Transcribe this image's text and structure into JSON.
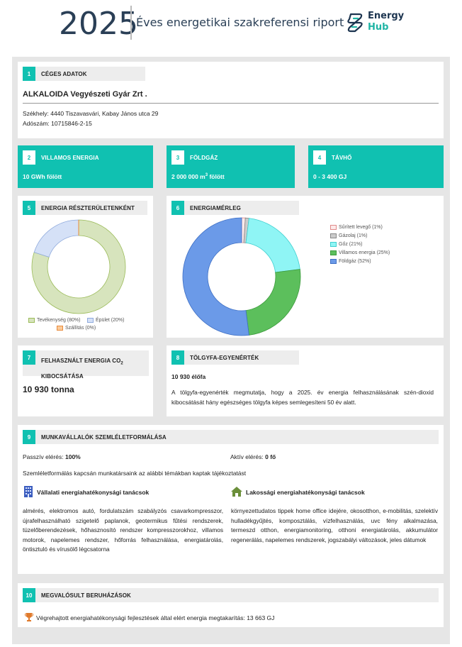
{
  "header": {
    "year": "2025",
    "title": "Éves energetikai szakreferensi riport",
    "logo_line1": "Energy",
    "logo_line2": "Hub"
  },
  "company": {
    "num": "1",
    "title": "CÉGES ADATOK",
    "name": "ALKALOIDA Vegyészeti Gyár Zrt .",
    "address": "Székhely: 4440 Tiszavasvári, Kabay János utca 29",
    "tax": "Adószám: 10715846-2-15"
  },
  "electric": {
    "num": "2",
    "title": "VILLAMOS ENERGIA",
    "value": "10 GWh fölött"
  },
  "gas": {
    "num": "3",
    "title": "FÖLDGÁZ",
    "value_main": "2 000 000 m",
    "value_sup": "3",
    "value_tail": " fölött"
  },
  "district": {
    "num": "4",
    "title": "TÁVHŐ",
    "value": "0 - 3 400 GJ"
  },
  "energy_area": {
    "num": "5",
    "title": "ENERGIA RÉSZTERÜLETENKÉNT",
    "legend": [
      {
        "label": "Tevékenység (80%)",
        "color": "#d7e4bd",
        "stroke": "#9bbb59"
      },
      {
        "label": "Épület (20%)",
        "color": "#d5e1f7",
        "stroke": "#8faadc"
      },
      {
        "label": "Szállítás (0%)",
        "color": "#fbcb9a",
        "stroke": "#e88b3c"
      }
    ]
  },
  "energy_balance": {
    "num": "6",
    "title": "ENERGIAMÉRLEG",
    "legend": [
      {
        "label": "Sűrített levegő (1%)",
        "color": "#fdeaea",
        "stroke": "#e08a8a"
      },
      {
        "label": "Gázolaj (1%)",
        "color": "#cccccc",
        "stroke": "#888888"
      },
      {
        "label": "Gőz (21%)",
        "color": "#8ff5f5",
        "stroke": "#3fd0d0"
      },
      {
        "label": "Villamos energia (25%)",
        "color": "#5cbf5c",
        "stroke": "#3c9a3c"
      },
      {
        "label": "Földgáz (52%)",
        "color": "#6b9ae8",
        "stroke": "#3e6fc4"
      }
    ]
  },
  "chart_data": [
    {
      "type": "pie",
      "categories": [
        "Tevékenység",
        "Épület",
        "Szállítás"
      ],
      "values": [
        80,
        20,
        0
      ],
      "colors": [
        "#d7e4bd",
        "#d5e1f7",
        "#fbcb9a"
      ],
      "legend": "bottom"
    },
    {
      "type": "pie",
      "categories": [
        "Sűrített levegő",
        "Gázolaj",
        "Gőz",
        "Villamos energia",
        "Földgáz"
      ],
      "values": [
        1,
        1,
        21,
        25,
        52
      ],
      "colors": [
        "#fdeaea",
        "#cccccc",
        "#8ff5f5",
        "#5cbf5c",
        "#6b9ae8"
      ],
      "legend": "right"
    }
  ],
  "co2": {
    "num": "7",
    "title_a": "FELHASZNÁLT ENERGIA CO",
    "title_sub": "2",
    "title_b": "KIBOCSÁTÁSA",
    "value": "10 930 tonna"
  },
  "oak": {
    "num": "8",
    "title": "TÖLGYFA-EGYENÉRTÉK",
    "value": "10 930 élőfa",
    "desc": "A tölgyfa-egyenérték megmutatja, hogy a 2025. év energia felhasználásának szén-dioxid kibocsátását hány egészséges tölgyfa képes semlegesíteni 50 év alatt."
  },
  "awareness": {
    "num": "9",
    "title": "MUNKAVÁLLALÓK SZEMLÉLETFORMÁLÁSA",
    "passive_label": "Passzív elérés: ",
    "passive_value": "100%",
    "active_label": "Aktív elérés: ",
    "active_value": "0 fő",
    "intro": "Szemléletformálás kapcsán munkatársaink az alábbi témákban kaptak tájékoztatást",
    "corp_title": "Vállalati energiahatékonysági tanácsok",
    "corp_text": "almérés, elektromos autó, fordulatszám szabályzós csavarkompresszor, újrafelhasználható szigetelő paplanok, geotermikus fűtési rendszerek, tüzelőberendezések, hőhasznosító rendszer kompresszorokhoz, villamos motorok, napelemes rendszer, hőforrás felhasználása, energiatárolás, öntisztuló és vírusölő légcsatorna",
    "home_title": "Lakossági energiahatékonysági tanácsok",
    "home_text": "környezettudatos tippek home office idejére, okosotthon, e-mobilitás, szelektív hulladékgyűjtés, komposztálás, vízfelhasználás, uvc fény alkalmazása, termeszd otthon, energiamonitoring, otthoni energiatárolás, akkumulátor regenerálás, napelemes rendszerek, jogszabályi változások, jeles dátumok"
  },
  "investments": {
    "num": "10",
    "title": "MEGVALÓSULT BERUHÁZÁSOK",
    "text": "Végrehajtott energiahatékonysági fejlesztések által elért energia megtakarítás: 13 663 GJ"
  }
}
